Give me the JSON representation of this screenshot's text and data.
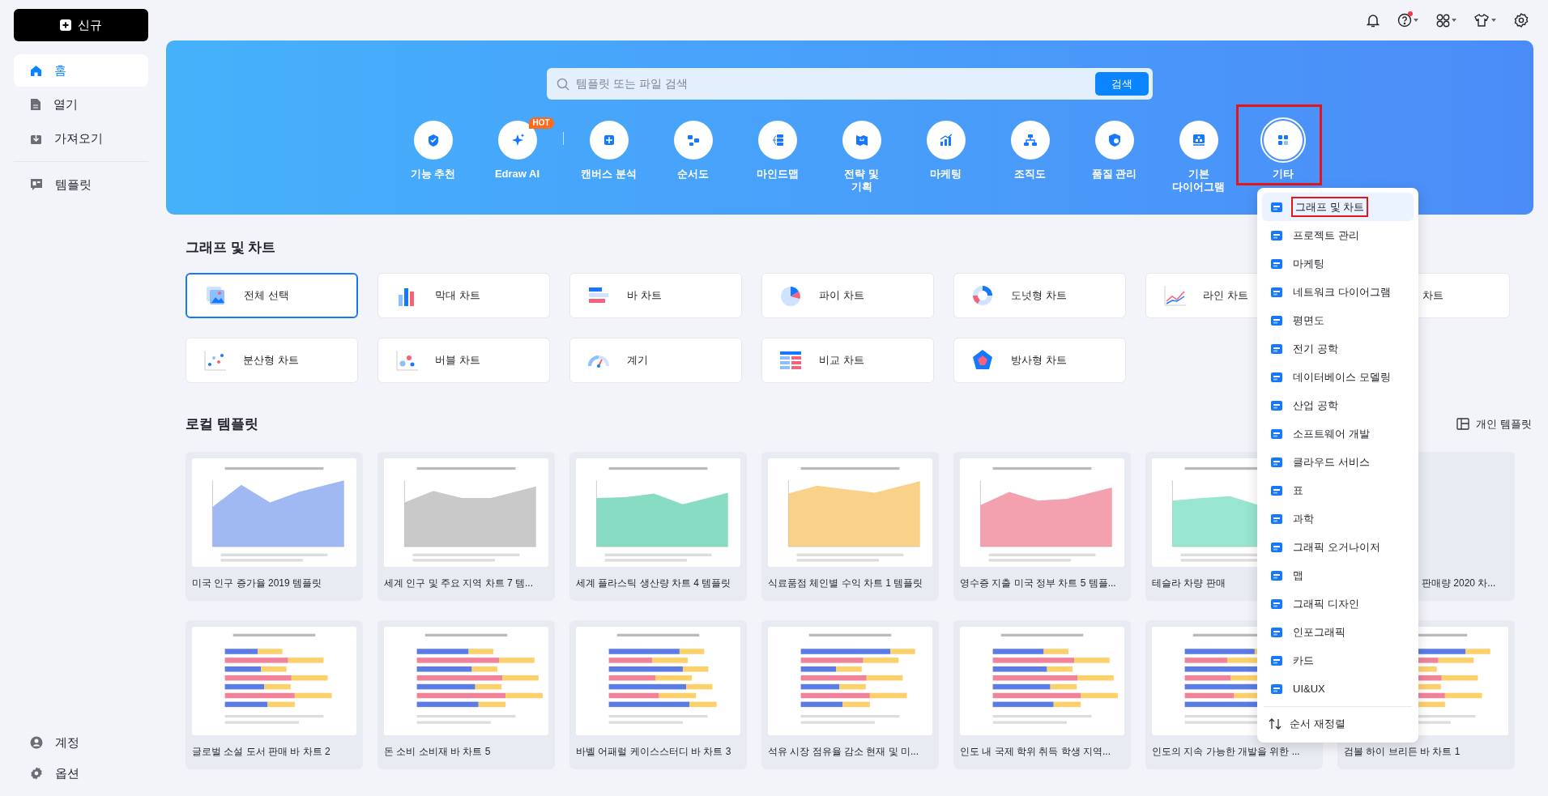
{
  "sidebar": {
    "new_button": "신규",
    "nav": [
      {
        "label": "홈",
        "selected": true
      },
      {
        "label": "열기",
        "selected": false
      },
      {
        "label": "가져오기",
        "selected": false
      }
    ],
    "nav_secondary": [
      {
        "label": "템플릿",
        "selected": false
      }
    ],
    "bottom": [
      {
        "label": "계정"
      },
      {
        "label": "옵션"
      }
    ]
  },
  "banner": {
    "search": {
      "placeholder": "템플릿 또는 파일 검색",
      "button": "검색"
    },
    "categories": [
      {
        "label": "기능 추천",
        "selected": false
      },
      {
        "label": "Edraw AI",
        "selected": false,
        "badge": "HOT"
      },
      {
        "label": "캔버스 분석",
        "selected": false
      },
      {
        "label": "순서도",
        "selected": false
      },
      {
        "label": "마인드맵",
        "selected": false
      },
      {
        "label": "전략 및\n기획",
        "selected": false
      },
      {
        "label": "마케팅",
        "selected": false
      },
      {
        "label": "조직도",
        "selected": false
      },
      {
        "label": "품질 관리",
        "selected": false
      },
      {
        "label": "기본\n다이어그램",
        "selected": false
      },
      {
        "label": "기타",
        "selected": true
      }
    ]
  },
  "chart_section": {
    "title": "그래프 및 차트",
    "types": [
      {
        "label": "전체 선택",
        "selected": true
      },
      {
        "label": "막대 차트",
        "selected": false
      },
      {
        "label": "바 차트",
        "selected": false
      },
      {
        "label": "파이 차트",
        "selected": false
      },
      {
        "label": "도넛형 차트",
        "selected": false
      },
      {
        "label": "라인 차트",
        "selected": false
      },
      {
        "label": "차트",
        "selected": false
      },
      {
        "label": "분산형 차트",
        "selected": false
      },
      {
        "label": "버블 차트",
        "selected": false
      },
      {
        "label": "계기",
        "selected": false
      },
      {
        "label": "비교 차트",
        "selected": false
      },
      {
        "label": "방사형 차트",
        "selected": false
      }
    ]
  },
  "local_templates": {
    "title": "로컬 템플릿",
    "personal_button": "개인 템플릿",
    "templates": [
      {
        "title": "미국 인구 증가율 2019 템플릿"
      },
      {
        "title": "세계 인구 및 주요 지역 차트 7 템..."
      },
      {
        "title": "세계 플라스틱 생산량 차트 4 템플릿"
      },
      {
        "title": "식료품점 체인별 수익 차트 1 템플릿"
      },
      {
        "title": "영수증 지출 미국 정부 차트 5 템플..."
      },
      {
        "title": "테슬라 차량 판매"
      },
      {
        "title": "판매량 2020 차..."
      },
      {
        "title": "글로벌 소설 도서 판매 바 차트 2"
      },
      {
        "title": "돈 소비 소비재 바 차트 5"
      },
      {
        "title": "바벨 어패럴 케이스스터디 바 차트 3"
      },
      {
        "title": "석유 시장 점유율 감소 현재 및 미..."
      },
      {
        "title": "인도 내 국제 학위 취득 학생 지역..."
      },
      {
        "title": "인도의 지속 가능한 개발을 위한 ..."
      },
      {
        "title": "검볼 하이 브리든 바 차트 1"
      }
    ]
  },
  "dropdown": {
    "items": [
      {
        "label": "그래프 및 차트",
        "selected": true
      },
      {
        "label": "프로젝트 관리",
        "selected": false
      },
      {
        "label": "마케팅",
        "selected": false
      },
      {
        "label": "네트워크 다이어그램",
        "selected": false
      },
      {
        "label": "평면도",
        "selected": false
      },
      {
        "label": "전기 공학",
        "selected": false
      },
      {
        "label": "데이터베이스 모델링",
        "selected": false
      },
      {
        "label": "산업 공학",
        "selected": false
      },
      {
        "label": "소프트웨어 개발",
        "selected": false
      },
      {
        "label": "클라우드 서비스",
        "selected": false
      },
      {
        "label": "표",
        "selected": false
      },
      {
        "label": "과학",
        "selected": false
      },
      {
        "label": "그래픽 오거나이저",
        "selected": false
      },
      {
        "label": "맵",
        "selected": false
      },
      {
        "label": "그래픽 디자인",
        "selected": false
      },
      {
        "label": "인포그래픽",
        "selected": false
      },
      {
        "label": "카드",
        "selected": false
      },
      {
        "label": "UI&UX",
        "selected": false
      }
    ],
    "footer": "순서 재정렬"
  }
}
